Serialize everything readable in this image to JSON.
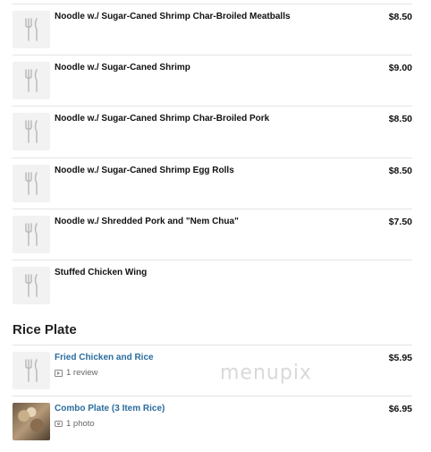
{
  "items_top": [
    {
      "name": "Noodle w./ Sugar-Caned Shrimp Char-Broiled Meatballs",
      "price": "$8.50",
      "icon": "utensils-icon"
    },
    {
      "name": "Noodle w./ Sugar-Caned Shrimp",
      "price": "$9.00",
      "icon": "utensils-icon"
    },
    {
      "name": "Noodle w./ Sugar-Caned Shrimp Char-Broiled Pork",
      "price": "$8.50",
      "icon": "utensils-icon"
    },
    {
      "name": "Noodle w./ Sugar-Caned Shrimp Egg Rolls",
      "price": "$8.50",
      "icon": "utensils-icon"
    },
    {
      "name": "Noodle w./ Shredded Pork and \"Nem Chua\"",
      "price": "$7.50",
      "icon": "utensils-icon"
    },
    {
      "name": "Stuffed Chicken Wing",
      "price": "",
      "icon": "utensils-icon"
    }
  ],
  "rice_section": {
    "title": "Rice Plate",
    "items": [
      {
        "name": "Fried Chicken and Rice",
        "price": "$5.95",
        "meta": "1 review",
        "icon": "utensils-icon"
      },
      {
        "name": "Combo Plate (3 Item Rice)",
        "price": "$6.95",
        "meta": "1 photo",
        "icon": "food-photo"
      }
    ]
  },
  "watermark": "menupix",
  "colors": {
    "link": "#2a6c9e",
    "divider": "#e4e4e4",
    "thumb_bg": "#f2f2f2"
  }
}
